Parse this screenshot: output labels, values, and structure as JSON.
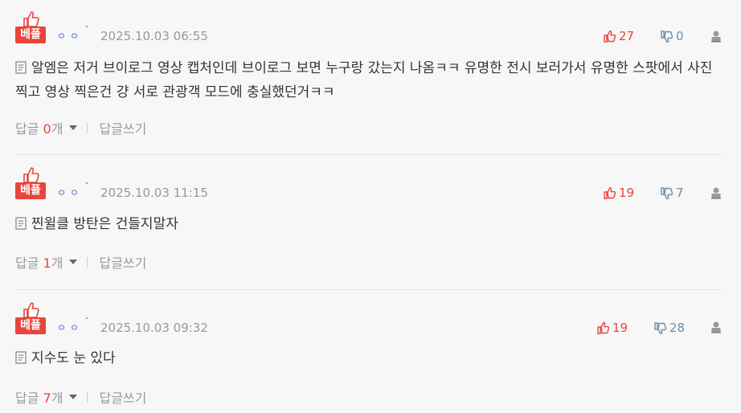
{
  "comments": [
    {
      "badge": "베플",
      "nick_dots": "ㅇㅇ",
      "date": "2025.10.03 06:55",
      "up": "27",
      "down": "0",
      "text": "알엠은 저거 브이로그 영상 캡처인데 브이로그 보면 누구랑 갔는지 나옴ㅋㅋ 유명한 전시 보러가서 유명한 스팟에서 사진 찍고 영상 찍은건 걍 서로 관광객 모드에 충실했던거ㅋㅋ",
      "reply_label": "답글",
      "reply_count": "0",
      "reply_unit": "개",
      "write_label": "답글쓰기"
    },
    {
      "badge": "베플",
      "nick_dots": "ㅇㅇ",
      "date": "2025.10.03 11:15",
      "up": "19",
      "down": "7",
      "text": "찐윌클 방탄은 건들지말자",
      "reply_label": "답글",
      "reply_count": "1",
      "reply_unit": "개",
      "write_label": "답글쓰기"
    },
    {
      "badge": "베플",
      "nick_dots": "ㅇㅇ",
      "date": "2025.10.03 09:32",
      "up": "19",
      "down": "28",
      "text": "지수도 눈 있다",
      "reply_label": "답글",
      "reply_count": "7",
      "reply_unit": "개",
      "write_label": "답글쓰기"
    }
  ],
  "colors": {
    "badge": "#e8453c",
    "up": "#e8453c",
    "down": "#6b8fa8",
    "date": "#999999"
  },
  "icons": [
    "thumbs-up-icon",
    "thumbs-down-icon",
    "report-icon",
    "document-icon",
    "chevron-down-icon"
  ]
}
